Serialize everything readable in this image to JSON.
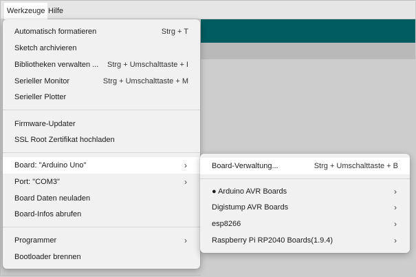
{
  "menubar": {
    "werkzeuge": "Werkzeuge",
    "hilfe": "Hilfe"
  },
  "tools_menu": {
    "items": [
      {
        "label": "Automatisch formatieren",
        "shortcut": "Strg + T"
      },
      {
        "label": "Sketch archivieren",
        "shortcut": ""
      },
      {
        "label": "Bibliotheken verwalten ...",
        "shortcut": "Strg + Umschalttaste + I"
      },
      {
        "label": "Serieller Monitor",
        "shortcut": "Strg + Umschalttaste + M"
      },
      {
        "label": "Serieller Plotter",
        "shortcut": ""
      },
      {
        "label": "Firmware-Updater",
        "shortcut": ""
      },
      {
        "label": "SSL Root Zertifikat hochladen",
        "shortcut": ""
      },
      {
        "label": "Board: \"Arduino Uno\"",
        "submenu": true
      },
      {
        "label": "Port: \"COM3\"",
        "submenu": true
      },
      {
        "label": "Board Daten neuladen",
        "shortcut": ""
      },
      {
        "label": "Board-Infos abrufen",
        "shortcut": ""
      },
      {
        "label": "Programmer",
        "submenu": true
      },
      {
        "label": "Bootloader brennen",
        "shortcut": ""
      }
    ],
    "chevron": "›"
  },
  "board_submenu": {
    "items": [
      {
        "label": "Board-Verwaltung...",
        "shortcut": "Strg + Umschalttaste + B"
      },
      {
        "label": "● Arduino AVR Boards",
        "submenu": true
      },
      {
        "label": "Digistump AVR Boards",
        "submenu": true
      },
      {
        "label": "esp8266",
        "submenu": true
      },
      {
        "label": "Raspberry Pi RP2040 Boards(1.9.4)",
        "submenu": true
      }
    ]
  }
}
